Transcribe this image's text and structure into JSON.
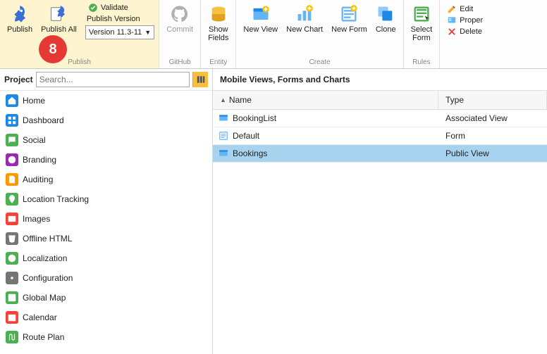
{
  "ribbon": {
    "publish_group": {
      "publish_label": "Publish",
      "publish_all_label": "Publish All",
      "validate_label": "Validate",
      "publish_version_label": "Publish Version",
      "version_value": "Version 11.3-11",
      "caption": "Publish"
    },
    "github_group": {
      "commit_label": "Commit",
      "caption": "GitHub"
    },
    "entity_group": {
      "show_fields_label": "Show\nFields",
      "caption": "Entity"
    },
    "create_group": {
      "new_view_label": "New View",
      "new_chart_label": "New Chart",
      "new_form_label": "New Form",
      "clone_label": "Clone",
      "caption": "Create"
    },
    "rules_group": {
      "select_form_label": "Select\nForm",
      "caption": "Rules"
    },
    "edit_group": {
      "edit_label": "Edit",
      "properties_label": "Proper",
      "delete_label": "Delete"
    },
    "step_badge": "8"
  },
  "sidebar": {
    "title": "Project",
    "search_placeholder": "Search...",
    "items": [
      {
        "label": "Home",
        "color": "#1e88e5",
        "icon": "home"
      },
      {
        "label": "Dashboard",
        "color": "#1e88e5",
        "icon": "dash"
      },
      {
        "label": "Social",
        "color": "#4caf50",
        "icon": "social"
      },
      {
        "label": "Branding",
        "color": "#9c27b0",
        "icon": "brand"
      },
      {
        "label": "Auditing",
        "color": "#ff9800",
        "icon": "audit"
      },
      {
        "label": "Location Tracking",
        "color": "#4caf50",
        "icon": "loc"
      },
      {
        "label": "Images",
        "color": "#f44336",
        "icon": "img"
      },
      {
        "label": "Offline HTML",
        "color": "#757575",
        "icon": "html"
      },
      {
        "label": "Localization",
        "color": "#4caf50",
        "icon": "loc2"
      },
      {
        "label": "Configuration",
        "color": "#757575",
        "icon": "cfg"
      },
      {
        "label": "Global Map",
        "color": "#4caf50",
        "icon": "map"
      },
      {
        "label": "Calendar",
        "color": "#f44336",
        "icon": "cal"
      },
      {
        "label": "Route Plan",
        "color": "#4caf50",
        "icon": "route"
      }
    ]
  },
  "content": {
    "title": "Mobile Views, Forms and Charts",
    "columns": {
      "name": "Name",
      "type": "Type"
    },
    "rows": [
      {
        "name": "BookingList",
        "type": "Associated View",
        "icon": "view",
        "selected": false
      },
      {
        "name": "Default",
        "type": "Form",
        "icon": "form",
        "selected": false
      },
      {
        "name": "Bookings",
        "type": "Public View",
        "icon": "view",
        "selected": true
      }
    ]
  }
}
